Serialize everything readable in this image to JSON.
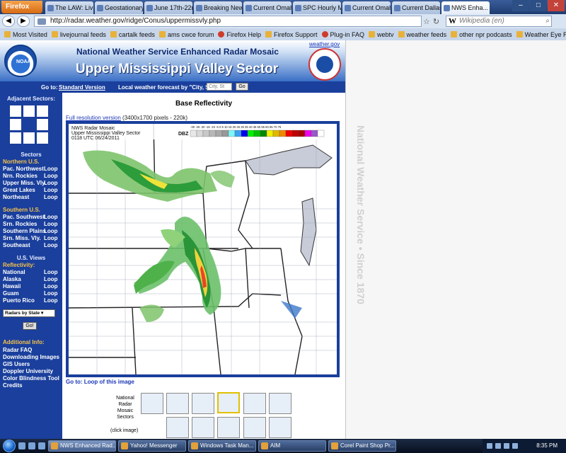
{
  "browser": {
    "menu_button": "Firefox",
    "tabs": [
      {
        "label": "The LAW: Live ...",
        "active": false
      },
      {
        "label": "Geostationary ...",
        "active": false
      },
      {
        "label": "June 17th-22n...",
        "active": false
      },
      {
        "label": "Breaking New...",
        "active": false
      },
      {
        "label": "Current Omah...",
        "active": false
      },
      {
        "label": "SPC Hourly M...",
        "active": false
      },
      {
        "label": "Current Omah...",
        "active": false
      },
      {
        "label": "Current Dallas...",
        "active": false
      },
      {
        "label": "NWS Enha...",
        "active": true
      }
    ],
    "window_controls": [
      "–",
      "□",
      "✕"
    ],
    "nav": {
      "back": "◀",
      "forward": "▶"
    },
    "url": "http://radar.weather.gov/ridge/Conus/uppermissvly.php",
    "search_placeholder": "Wikipedia (en)",
    "search_engine_glyph": "W",
    "bookmarks": [
      "Most Visited",
      "livejournal feeds",
      "cartalk feeds",
      "ams cwce forum",
      "Firefox Help",
      "Firefox Support",
      "Plug-in FAQ",
      "webtv",
      "weather feeds",
      "other npr podcasts",
      "Weather Eye Radio Ne..."
    ]
  },
  "header": {
    "noaa_logo_text": "NOAA",
    "title": "National Weather Service Enhanced Radar Mosaic",
    "sector": "Upper Mississippi Valley Sector",
    "top_link": "weather.gov"
  },
  "goto_bar": {
    "goto_label": "Go to:",
    "standard_version": "Standard Version",
    "forecast_label": "Local weather forecast by \"City, St\"",
    "city_placeholder": "City, St",
    "go_button": "Go"
  },
  "sidebar": {
    "adjacent_title": "Adjacent Sectors:",
    "sectors_title": "Sectors",
    "northern_title": "Northern U.S.",
    "northern_items": [
      {
        "name": "Pac. Northwest",
        "loop": "Loop"
      },
      {
        "name": "Nrn. Rockies",
        "loop": "Loop"
      },
      {
        "name": "Upper Miss. Vly.",
        "loop": "Loop"
      },
      {
        "name": "Great Lakes",
        "loop": "Loop"
      },
      {
        "name": "Northeast",
        "loop": "Loop"
      }
    ],
    "southern_title": "Southern U.S.",
    "southern_items": [
      {
        "name": "Pac. Southwest",
        "loop": "Loop"
      },
      {
        "name": "Srn. Rockies",
        "loop": "Loop"
      },
      {
        "name": "Southern Plains",
        "loop": "Loop"
      },
      {
        "name": "Srn. Miss. Vly.",
        "loop": "Loop"
      },
      {
        "name": "Southeast",
        "loop": "Loop"
      }
    ],
    "us_views_title": "U.S. Views",
    "reflectivity_title": "Reflectivity:",
    "views_items": [
      {
        "name": "National",
        "loop": "Loop"
      },
      {
        "name": "Alaska",
        "loop": "Loop"
      },
      {
        "name": "Hawaii",
        "loop": "Loop"
      },
      {
        "name": "Guam",
        "loop": "Loop"
      },
      {
        "name": "Puerto Rico",
        "loop": "Loop"
      }
    ],
    "radars_select": "Radars by State",
    "radars_go": "Go!",
    "additional_title": "Additional Info:",
    "additional_links": [
      "Radar FAQ",
      "Downloading Images",
      "GIS Users",
      "Doppler University",
      "Color Blindness Tool",
      "Credits"
    ]
  },
  "main": {
    "title": "Base Reflectivity",
    "full_res_link": "Full resolution version",
    "full_res_info": " (3400x1700 pixels - 220k)",
    "map_label_1": "NWS Radar Mosaic",
    "map_label_2": "Upper Mississippi Valley Sector",
    "map_label_3": "0118 UTC 06/24/2011",
    "dbz_label": "DBZ",
    "dbz_ticks": "-30 -25 -20 -15 -10 -5  0  5 10 15 20 25 30 35 40 45 50 55 60 65 70 75",
    "loop_link": "Go to: Loop of this image",
    "mosaic_label": "National Radar Mosaic Sectors",
    "click_label": "(click image)"
  },
  "right_watermark": "National Weather Service • Since 1870",
  "taskbar": {
    "buttons": [
      {
        "label": "NWS Enhanced Rad...",
        "active": true
      },
      {
        "label": "Yahoo! Messenger",
        "active": false
      },
      {
        "label": "Windows Task Man...",
        "active": false
      },
      {
        "label": "AIM",
        "active": false
      },
      {
        "label": "Corel Paint Shop Pr...",
        "active": false
      }
    ],
    "clock": "8:35 PM"
  }
}
